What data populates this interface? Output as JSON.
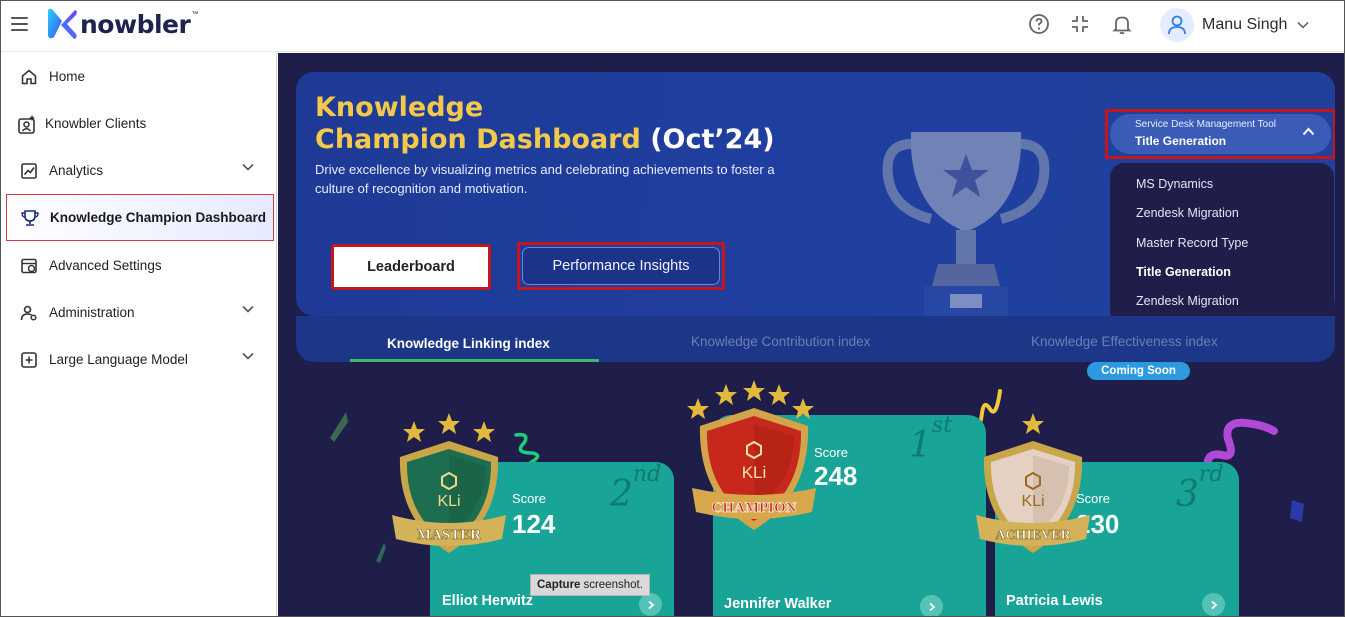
{
  "app": {
    "logo_text": "nowbler",
    "logo_tm": "™"
  },
  "header": {
    "user_name": "Manu Singh",
    "icons": [
      "help-icon",
      "collapse-icon",
      "bell-icon",
      "user-avatar-icon"
    ]
  },
  "sidebar": {
    "items": [
      {
        "label": "Home",
        "icon": "home-icon",
        "has_chevron": false
      },
      {
        "label": "Knowbler Clients",
        "icon": "clients-icon",
        "has_chevron": false
      },
      {
        "label": "Analytics",
        "icon": "analytics-icon",
        "has_chevron": true
      },
      {
        "label": "Knowledge Champion Dashboard",
        "icon": "trophy-icon",
        "has_chevron": false,
        "active": true
      },
      {
        "label": "Advanced Settings",
        "icon": "settings-icon",
        "has_chevron": false
      },
      {
        "label": "Administration",
        "icon": "admin-icon",
        "has_chevron": true
      },
      {
        "label": "Large Language Model",
        "icon": "llm-icon",
        "has_chevron": true
      }
    ]
  },
  "hero": {
    "title_line1": "Knowledge",
    "title_line2": "Champion Dashboard",
    "title_month": "(Oct’24)",
    "description": "Drive excellence by visualizing metrics and celebrating achievements to foster a culture of recognition and motivation.",
    "btn_leaderboard": "Leaderboard",
    "btn_insights": "Performance Insights"
  },
  "dropdown": {
    "caption": "Service Desk Management Tool",
    "value": "Title Generation",
    "options": [
      "MS Dynamics",
      "Zendesk Migration",
      "Master Record Type",
      "Title Generation",
      "Zendesk Migration"
    ],
    "selected_index": 3
  },
  "tabs": {
    "items": [
      "Knowledge Linking index",
      "Knowledge Contribution index",
      "Knowledge Effectiveness index"
    ],
    "active_index": 0,
    "coming_soon": "Coming Soon"
  },
  "badges": {
    "kli": "KLi",
    "master": "MASTER",
    "champion": "CHAMPION",
    "achiever": "ACHIEVER"
  },
  "leaderboard": [
    {
      "rank_num": "2",
      "rank_suffix": "nd",
      "score_label": "Score",
      "score": "124",
      "name": "Elliot Herwitz"
    },
    {
      "rank_num": "1",
      "rank_suffix": "st",
      "score_label": "Score",
      "score": "248",
      "name": "Jennifer Walker"
    },
    {
      "rank_num": "3",
      "rank_suffix": "rd",
      "score_label": "Score",
      "score": "230",
      "name": "Patricia Lewis"
    }
  ],
  "tooltip": {
    "bold": "Capture",
    "rest": "screenshot."
  },
  "colors": {
    "main_bg": "#1f1d4a",
    "hero_bg": "#1f3fa0",
    "title_gold": "#f4c84a",
    "card_teal": "#18a597",
    "highlight_red": "#c5161d"
  }
}
